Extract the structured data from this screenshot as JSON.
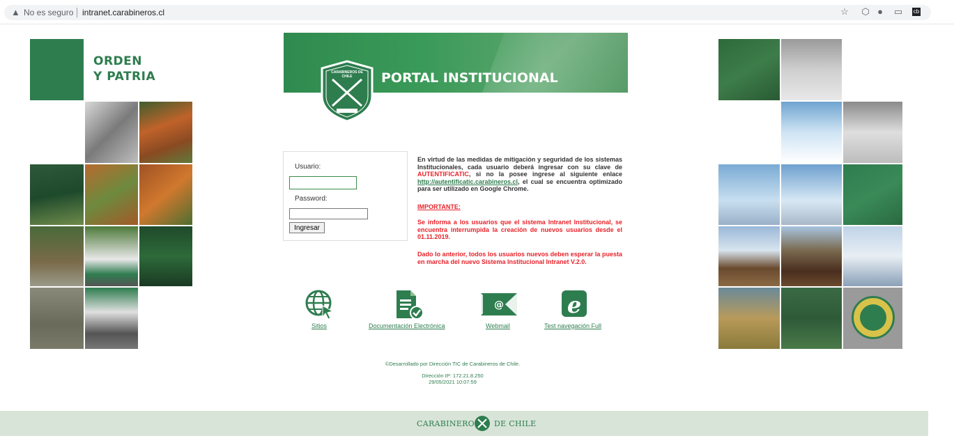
{
  "browser": {
    "security_label": "No es seguro",
    "url": "intranet.carabineros.cl"
  },
  "brand": {
    "slogan_line1": "ORDEN",
    "slogan_line2": "Y PATRIA"
  },
  "banner": {
    "title": "PORTAL INSTITUCIONAL",
    "badge_text_top": "CARABINEROS DE CHILE",
    "badge_text_bottom": "ORDEN Y PATRIA"
  },
  "login": {
    "user_label": "Usuario:",
    "user_value": "",
    "password_label": "Password:",
    "password_value": "",
    "submit_label": "Ingresar"
  },
  "notice": {
    "p1_a": "En virtud de las medidas de mitigación y seguridad de los sistemas Institucionales, cada usuario deberá ingresar con su clave de ",
    "p1_red": "AUTENTIFICATIC",
    "p1_b": ", si no la posee ingrese al siguiente enlace ",
    "p1_link": "http://autentificatic.carabineros.cl",
    "p1_c": ", el cual se encuentra optimizado para ser utilizado en Google Chrome.",
    "important": "IMPORTANTE:",
    "p2": "Se informa a los usuarios que el sistema Intranet Institucional, se encuentra interrumpida la creación de nuevos usuarios desde el 01.11.2019.",
    "p3": "Dado lo anterior, todos los usuarios nuevos deben esperar la puesta en marcha del nuevo Sistema Institucional Intranet V.2.0."
  },
  "quicklinks": [
    {
      "label": "Sitios",
      "icon": "globe-cursor-icon"
    },
    {
      "label": "Documentación Electrónica",
      "icon": "document-check-icon"
    },
    {
      "label": "Webmail",
      "icon": "envelope-at-icon"
    },
    {
      "label": "Test navegación Full",
      "icon": "browser-e-icon"
    }
  ],
  "credits": {
    "developer": "©Desarrollado por Dirección TIC de Carabineros de Chile.",
    "ip": "Dirección IP: 172.21.8.250",
    "datetime": "29/05/2021 10:07:59"
  },
  "footer": {
    "left": "CARABINEROS",
    "right": "DE CHILE"
  },
  "colors": {
    "brand_green": "#2e7d4f",
    "alert_red": "#e8232a"
  }
}
